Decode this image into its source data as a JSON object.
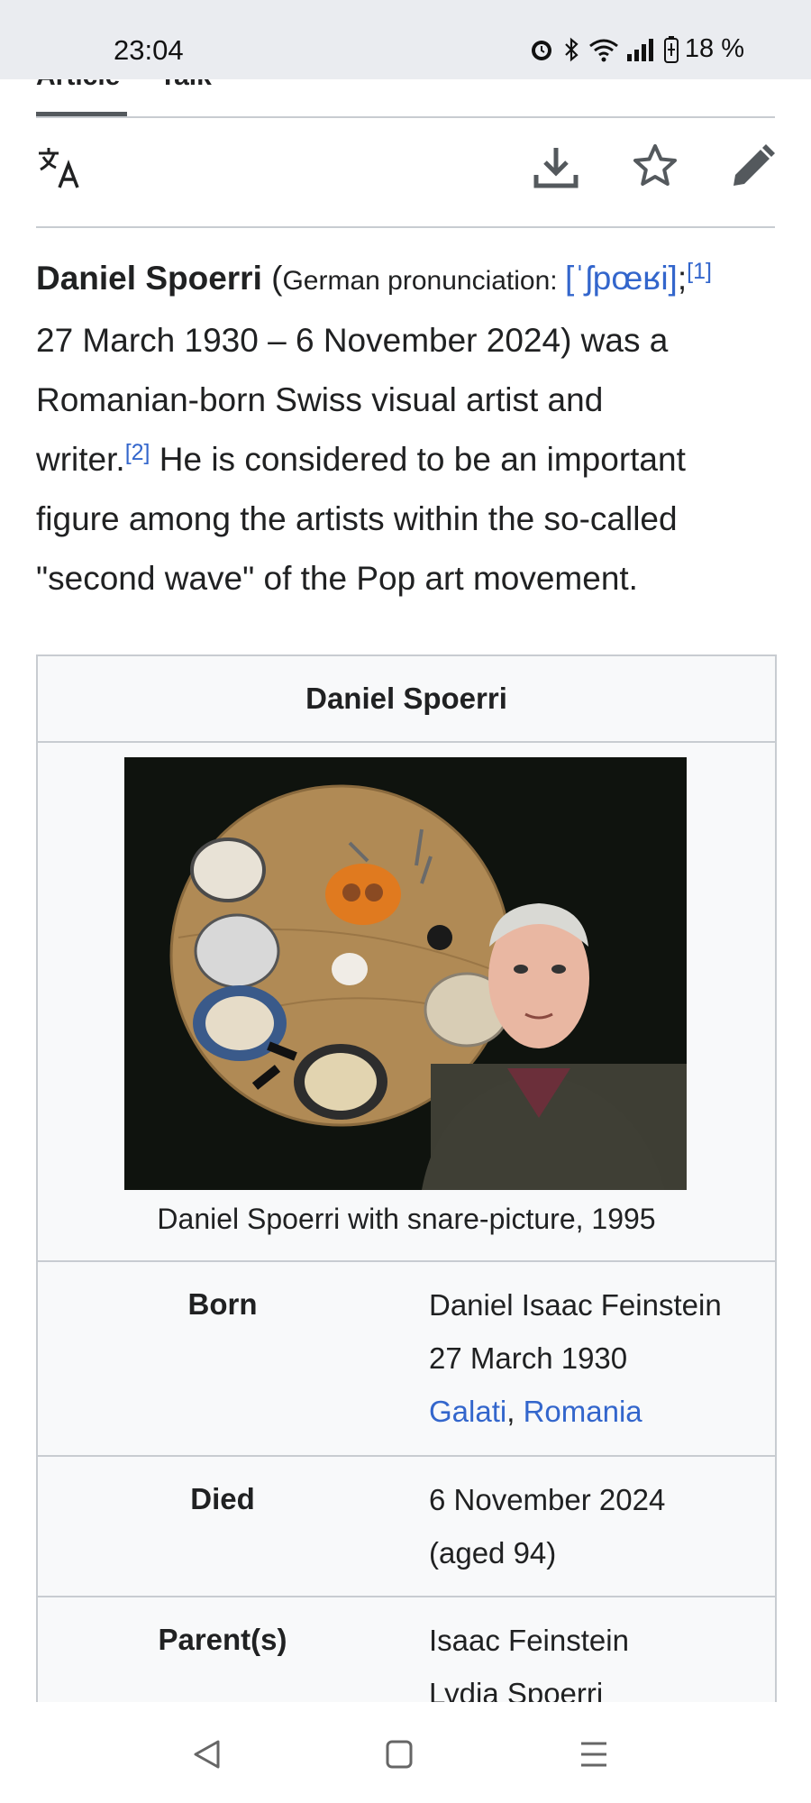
{
  "status_bar": {
    "time": "23:04",
    "battery": "18 %"
  },
  "tabs": [
    {
      "label": "Article"
    },
    {
      "label": "Talk"
    }
  ],
  "toolbar": {
    "icons": [
      "translate-icon",
      "download-icon",
      "star-icon",
      "edit-pencil-icon"
    ]
  },
  "article": {
    "subject": "Daniel Spoerri",
    "pron_open": " (",
    "pron_label": "German pronunciation: ",
    "ipa": "[ˈʃpœʁi]",
    "ref1": "[1]",
    "line2": "27 March 1930 – 6 November 2024) was a",
    "line3": "Romanian-born Swiss visual artist and",
    "line4_a": "writer.",
    "ref2": "[2]",
    "line4_b": " He is considered to be an important",
    "line5": "figure among the artists within the so-called",
    "line6": "\"second wave\" of the Pop art movement."
  },
  "infobox": {
    "title": "Daniel Spoerri",
    "caption": "Daniel Spoerri with snare-picture, 1995",
    "born_label": "Born",
    "born_name": "Daniel Isaac Feinstein",
    "born_date": "27 March 1930",
    "born_city": "Galati",
    "born_sep": ", ",
    "born_country": "Romania",
    "died_label": "Died",
    "died_date": "6 November 2024",
    "died_age": "(aged 94)",
    "parents_label": "Parent(s)",
    "parent1": "Isaac Feinstein",
    "parent2": "Lydia Spoerri"
  },
  "nav": {
    "icons": [
      "back-icon",
      "home-icon",
      "recents-icon"
    ]
  }
}
